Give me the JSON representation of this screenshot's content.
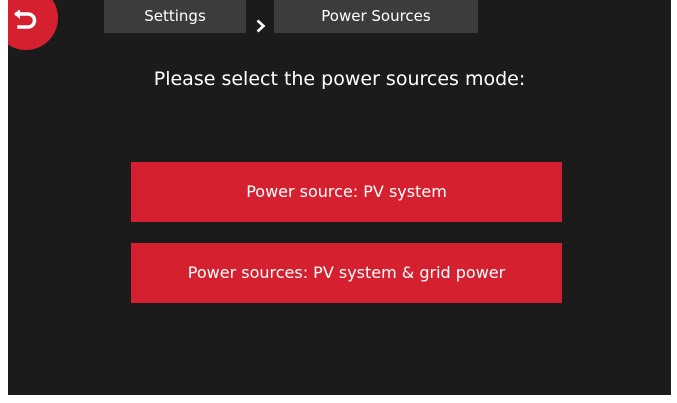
{
  "header": {
    "back_icon": "back-arrow-icon",
    "breadcrumb": {
      "items": [
        {
          "label": "Settings"
        },
        {
          "label": "Power Sources"
        }
      ],
      "separator_icon": "chevron-right-icon"
    }
  },
  "main": {
    "prompt": "Please select the power sources mode:",
    "options": [
      {
        "label": "Power source: PV system"
      },
      {
        "label": "Power sources: PV system & grid power"
      }
    ]
  },
  "colors": {
    "accent": "#d4202f",
    "background": "#1b1b1b",
    "breadcrumb_bg": "#3c3c3c",
    "text": "#ffffff"
  }
}
